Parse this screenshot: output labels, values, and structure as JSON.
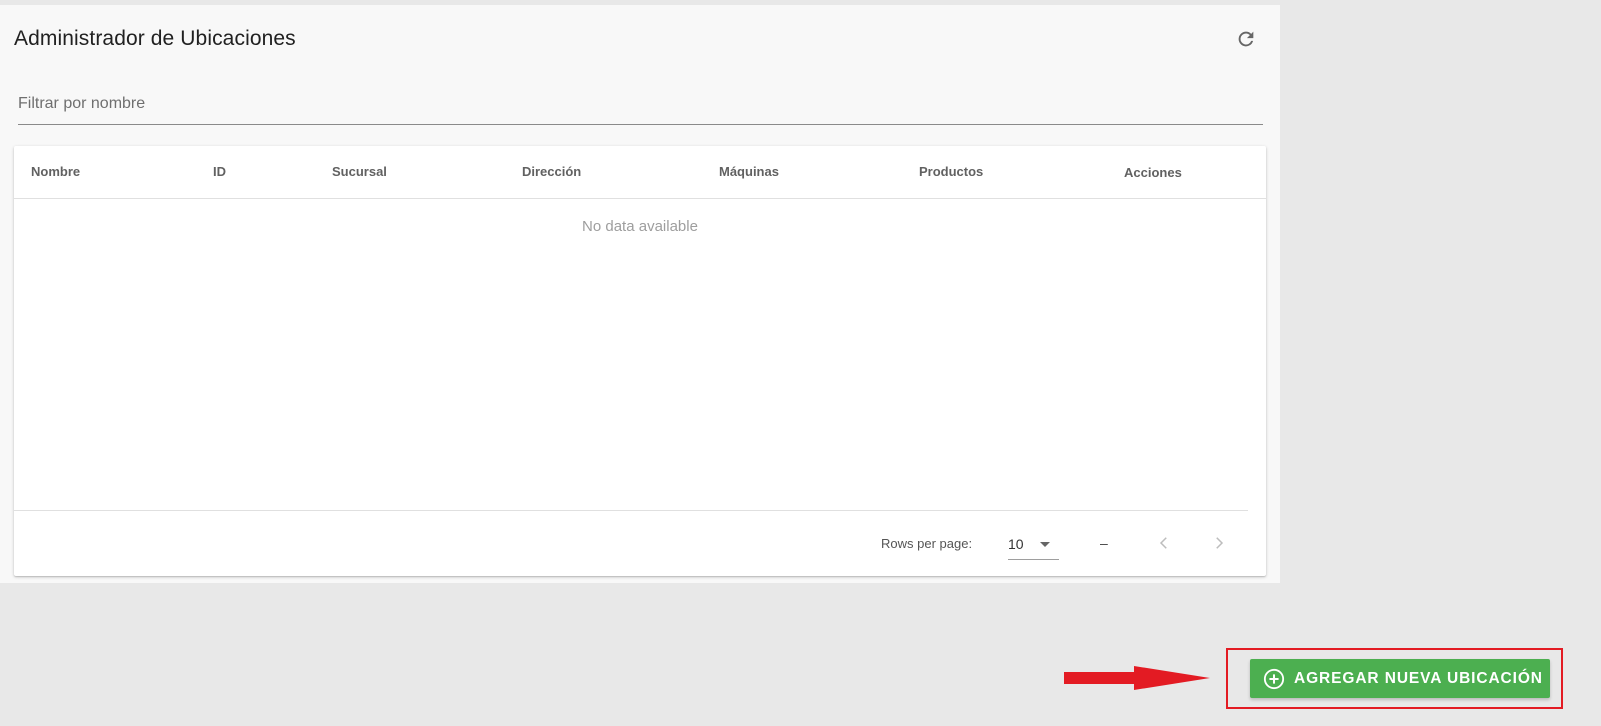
{
  "header": {
    "title": "Administrador de Ubicaciones",
    "refresh_icon": "refresh-icon"
  },
  "filter": {
    "placeholder": "Filtrar por nombre",
    "value": ""
  },
  "table": {
    "columns": [
      "Nombre",
      "ID",
      "Sucursal",
      "Dirección",
      "Máquinas",
      "Productos",
      "Acciones"
    ],
    "rows": [],
    "empty_text": "No data available"
  },
  "pagination": {
    "rows_per_page_label": "Rows per page:",
    "rows_per_page_value": "10",
    "range_text": "–",
    "prev_icon": "chevron-left-icon",
    "next_icon": "chevron-right-icon"
  },
  "add_button": {
    "label": "AGREGAR NUEVA UBICACIÓN",
    "icon": "plus-circle-icon",
    "color": "#4caf50"
  },
  "annotations": {
    "highlight_color": "#e31b23",
    "arrow_icon": "arrow-right-icon"
  }
}
